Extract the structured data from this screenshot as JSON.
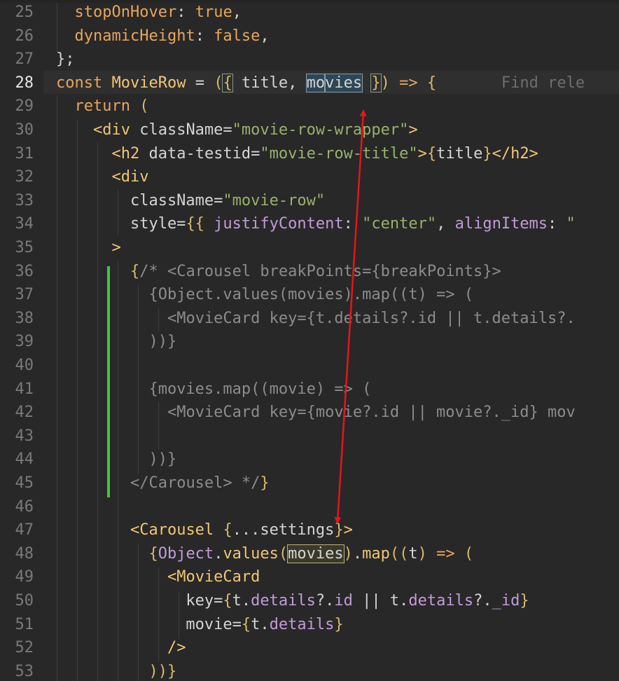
{
  "editor": {
    "active_line": "28",
    "lines": [
      {
        "n": "25",
        "segments": [
          {
            "t": "  "
          },
          {
            "t": "stopOnHover",
            "c": "kw"
          },
          {
            "t": ": "
          },
          {
            "t": "true",
            "c": "kw"
          },
          {
            "t": ","
          }
        ]
      },
      {
        "n": "26",
        "segments": [
          {
            "t": "  "
          },
          {
            "t": "dynamicHeight",
            "c": "kw"
          },
          {
            "t": ": "
          },
          {
            "t": "false",
            "c": "kw"
          },
          {
            "t": ","
          }
        ]
      },
      {
        "n": "27",
        "segments": [
          {
            "t": "};"
          }
        ]
      },
      {
        "n": "28",
        "segments": [
          {
            "t": "const ",
            "c": "kw"
          },
          {
            "t": "MovieRow",
            "c": "fn"
          },
          {
            "t": " = "
          },
          {
            "t": "(",
            "c": "br"
          },
          {
            "t": "{",
            "c": "br hl-paren"
          },
          {
            "t": " title, "
          },
          {
            "t": "mo",
            "c": "hl-movies"
          },
          {
            "cursor": true
          },
          {
            "t": "vies",
            "c": "hl-movies"
          },
          {
            "t": " "
          },
          {
            "t": "}",
            "c": "br hl-paren"
          },
          {
            "t": ")",
            "c": "br"
          },
          {
            "t": " "
          },
          {
            "t": "=>",
            "c": "kw"
          },
          {
            "t": " "
          },
          {
            "t": "{",
            "c": "br"
          },
          {
            "t": "       Find rele",
            "c": "hint"
          }
        ]
      },
      {
        "n": "29",
        "segments": [
          {
            "t": "  "
          },
          {
            "t": "return",
            "c": "kw"
          },
          {
            "t": " "
          },
          {
            "t": "(",
            "c": "br"
          }
        ]
      },
      {
        "n": "30",
        "segments": [
          {
            "t": "    "
          },
          {
            "t": "<div",
            "c": "tag"
          },
          {
            "t": " className="
          },
          {
            "t": "\"movie-row-wrapper\"",
            "c": "str"
          },
          {
            "t": ">",
            "c": "tag"
          }
        ]
      },
      {
        "n": "31",
        "segments": [
          {
            "t": "      "
          },
          {
            "t": "<h2",
            "c": "tag"
          },
          {
            "t": " data-testid="
          },
          {
            "t": "\"movie-row-title\"",
            "c": "str"
          },
          {
            "t": ">",
            "c": "tag"
          },
          {
            "t": "{",
            "c": "br"
          },
          {
            "t": "title"
          },
          {
            "t": "}",
            "c": "br"
          },
          {
            "t": "</h2>",
            "c": "tag"
          }
        ]
      },
      {
        "n": "32",
        "segments": [
          {
            "t": "      "
          },
          {
            "t": "<div",
            "c": "tag"
          }
        ]
      },
      {
        "n": "33",
        "segments": [
          {
            "t": "        className="
          },
          {
            "t": "\"movie-row\"",
            "c": "str"
          }
        ]
      },
      {
        "n": "34",
        "segments": [
          {
            "t": "        style="
          },
          {
            "t": "{{",
            "c": "br"
          },
          {
            "t": " "
          },
          {
            "t": "justifyContent",
            "c": "pr"
          },
          {
            "t": ": "
          },
          {
            "t": "\"center\"",
            "c": "str"
          },
          {
            "t": ", "
          },
          {
            "t": "alignItems",
            "c": "pr"
          },
          {
            "t": ": "
          },
          {
            "t": "\"",
            "c": "str"
          }
        ]
      },
      {
        "n": "35",
        "segments": [
          {
            "t": "      "
          },
          {
            "t": ">",
            "c": "tag"
          }
        ]
      },
      {
        "n": "36",
        "segments": [
          {
            "t": "        "
          },
          {
            "t": "{",
            "c": "br"
          },
          {
            "t": "/* <Carousel breakPoints={breakPoints}>",
            "c": "cm"
          }
        ]
      },
      {
        "n": "37",
        "segments": [
          {
            "t": "          "
          },
          {
            "t": "{Object.values(movies).map((t) => (",
            "c": "cm"
          }
        ]
      },
      {
        "n": "38",
        "segments": [
          {
            "t": "            "
          },
          {
            "t": "<MovieCard key={t.details?.id || t.details?.",
            "c": "cm"
          }
        ]
      },
      {
        "n": "39",
        "segments": [
          {
            "t": "          "
          },
          {
            "t": "))}",
            "c": "cm"
          }
        ]
      },
      {
        "n": "40",
        "segments": [
          {
            "t": ""
          }
        ]
      },
      {
        "n": "41",
        "segments": [
          {
            "t": "          "
          },
          {
            "t": "{movies.map((movie) => (",
            "c": "cm"
          }
        ]
      },
      {
        "n": "42",
        "segments": [
          {
            "t": "            "
          },
          {
            "t": "<MovieCard key={movie?.id || movie?._id} mov",
            "c": "cm"
          }
        ]
      },
      {
        "n": "43",
        "segments": [
          {
            "t": ""
          }
        ]
      },
      {
        "n": "44",
        "segments": [
          {
            "t": "          "
          },
          {
            "t": "))}",
            "c": "cm"
          }
        ]
      },
      {
        "n": "45",
        "segments": [
          {
            "t": "        "
          },
          {
            "t": "</Carousel> */",
            "c": "cm"
          },
          {
            "t": "}",
            "c": "br"
          }
        ]
      },
      {
        "n": "46",
        "segments": [
          {
            "t": ""
          }
        ]
      },
      {
        "n": "47",
        "segments": [
          {
            "t": "        "
          },
          {
            "t": "<Carousel",
            "c": "tag"
          },
          {
            "t": " "
          },
          {
            "t": "{",
            "c": "br"
          },
          {
            "t": "...settings"
          },
          {
            "t": "}",
            "c": "br"
          },
          {
            "t": ">",
            "c": "tag"
          }
        ]
      },
      {
        "n": "48",
        "segments": [
          {
            "t": "          "
          },
          {
            "t": "{",
            "c": "br"
          },
          {
            "t": "Object",
            "c": "pr"
          },
          {
            "t": "."
          },
          {
            "t": "values",
            "c": "fn"
          },
          {
            "t": "(",
            "c": "br"
          },
          {
            "t": "movies",
            "c": "hl-movies2"
          },
          {
            "t": ")",
            "c": "br"
          },
          {
            "t": "."
          },
          {
            "t": "map",
            "c": "fn"
          },
          {
            "t": "((",
            "c": "br"
          },
          {
            "t": "t"
          },
          {
            "t": ")",
            "c": "br"
          },
          {
            "t": " "
          },
          {
            "t": "=>",
            "c": "kw"
          },
          {
            "t": " "
          },
          {
            "t": "(",
            "c": "br"
          }
        ]
      },
      {
        "n": "49",
        "segments": [
          {
            "t": "            "
          },
          {
            "t": "<MovieCard",
            "c": "tag"
          }
        ]
      },
      {
        "n": "50",
        "segments": [
          {
            "t": "              key="
          },
          {
            "t": "{",
            "c": "br"
          },
          {
            "t": "t."
          },
          {
            "t": "details",
            "c": "pr"
          },
          {
            "t": "?."
          },
          {
            "t": "id",
            "c": "pr"
          },
          {
            "t": " || t."
          },
          {
            "t": "details",
            "c": "pr"
          },
          {
            "t": "?."
          },
          {
            "t": "_id",
            "c": "pr"
          },
          {
            "t": "}",
            "c": "br"
          }
        ]
      },
      {
        "n": "51",
        "segments": [
          {
            "t": "              movie="
          },
          {
            "t": "{",
            "c": "br"
          },
          {
            "t": "t."
          },
          {
            "t": "details",
            "c": "pr"
          },
          {
            "t": "}",
            "c": "br"
          }
        ]
      },
      {
        "n": "52",
        "segments": [
          {
            "t": "            "
          },
          {
            "t": "/>",
            "c": "tag"
          }
        ]
      },
      {
        "n": "53",
        "segments": [
          {
            "t": "          "
          },
          {
            "t": "))}",
            "c": "br"
          }
        ]
      }
    ]
  },
  "colors": {
    "background": "#282828",
    "git_added_bar": "#3fc63f",
    "annotation_arrow": "#e8141c"
  }
}
